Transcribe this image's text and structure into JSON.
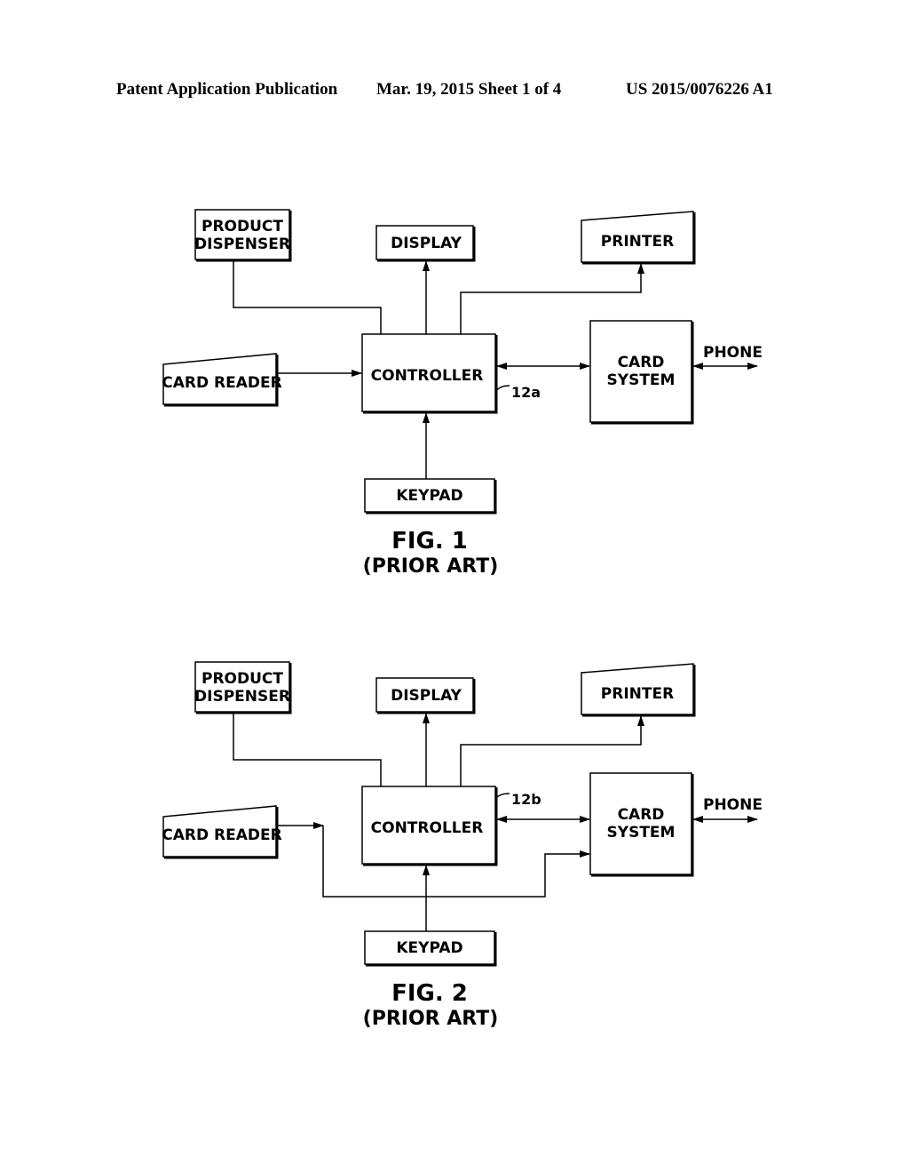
{
  "header": {
    "left": "Patent Application Publication",
    "middle": "Mar. 19, 2015  Sheet 1 of 4",
    "right": "US 2015/0076226 A1"
  },
  "fig1": {
    "product_dispenser_l1": "PRODUCT",
    "product_dispenser_l2": "DISPENSER",
    "display": "DISPLAY",
    "printer": "PRINTER",
    "card_reader": "CARD READER",
    "controller": "CONTROLLER",
    "card_system_l1": "CARD",
    "card_system_l2": "SYSTEM",
    "phone": "PHONE",
    "keypad": "KEYPAD",
    "ref": "12a",
    "title": "FIG. 1",
    "subtitle": "(PRIOR ART)"
  },
  "fig2": {
    "product_dispenser_l1": "PRODUCT",
    "product_dispenser_l2": "DISPENSER",
    "display": "DISPLAY",
    "printer": "PRINTER",
    "card_reader": "CARD READER",
    "controller": "CONTROLLER",
    "card_system_l1": "CARD",
    "card_system_l2": "SYSTEM",
    "phone": "PHONE",
    "keypad": "KEYPAD",
    "ref": "12b",
    "title": "FIG. 2",
    "subtitle": "(PRIOR ART)"
  }
}
